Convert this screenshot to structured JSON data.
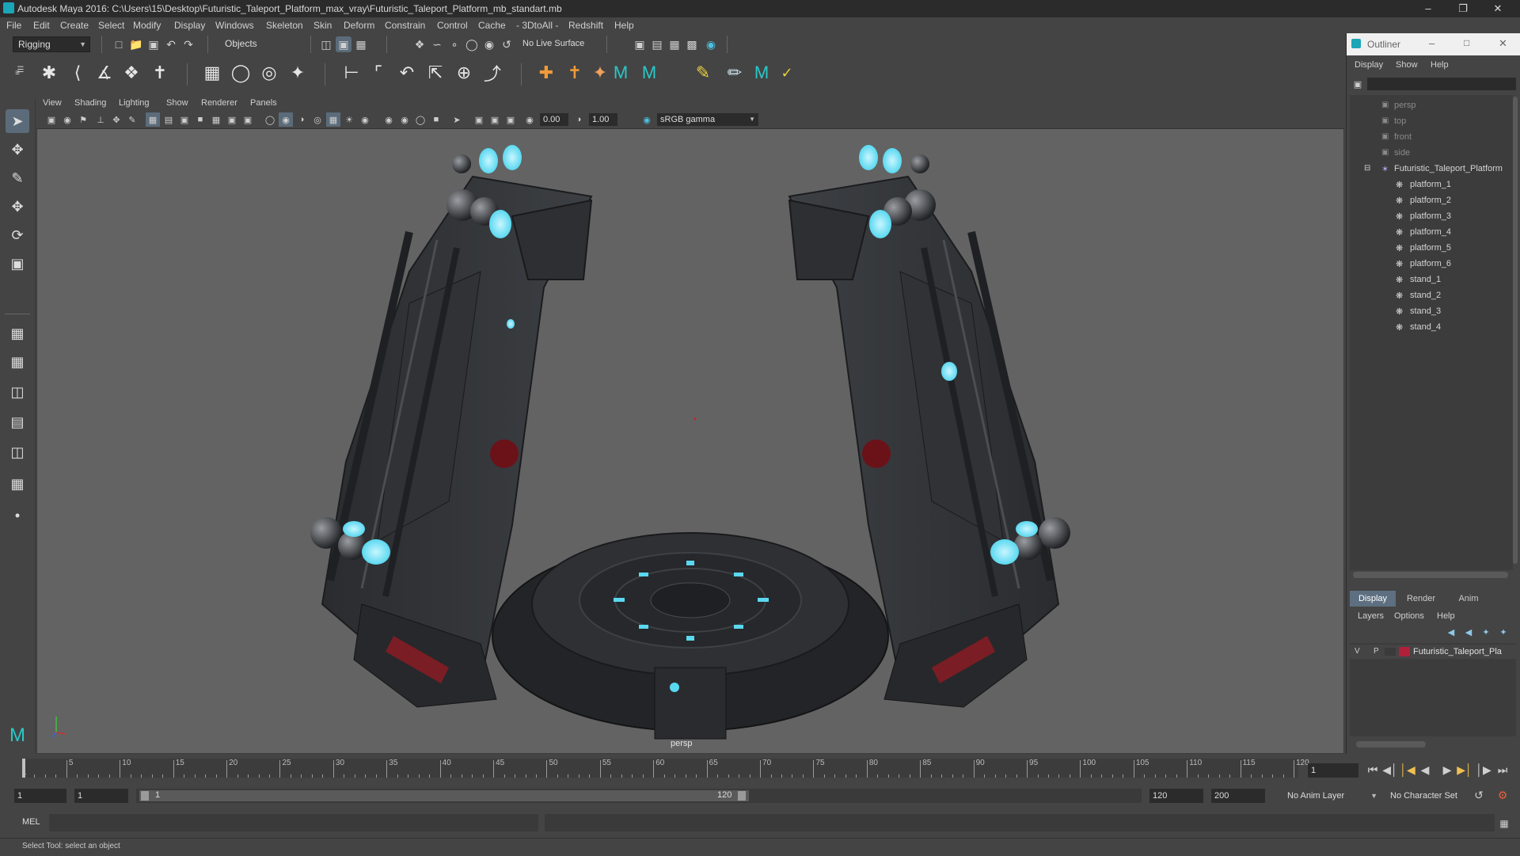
{
  "title_bar": {
    "title": "Autodesk Maya 2016: C:\\Users\\15\\Desktop\\Futuristic_Taleport_Platform_max_vray\\Futuristic_Taleport_Platform_mb_standart.mb"
  },
  "menu": [
    "File",
    "Edit",
    "Create",
    "Select",
    "Modify",
    "Display",
    "Windows",
    "Skeleton",
    "Skin",
    "Deform",
    "Constrain",
    "Control",
    "Cache",
    "- 3DtoAll -",
    "Redshift",
    "Help"
  ],
  "status_line": {
    "mode": "Rigging",
    "selection_mask": "Objects",
    "live_surface": "No Live Surface"
  },
  "viewport": {
    "menu": [
      "View",
      "Shading",
      "Lighting",
      "Show",
      "Renderer",
      "Panels"
    ],
    "exposure": "0.00",
    "gamma": "1.00",
    "color_space": "sRGB gamma",
    "camera_label": "persp"
  },
  "outliner": {
    "title": "Outliner",
    "menu": [
      "Display",
      "Show",
      "Help"
    ],
    "cameras": [
      "persp",
      "top",
      "front",
      "side"
    ],
    "group": "Futuristic_Taleport_Platform",
    "children": [
      "platform_1",
      "platform_2",
      "platform_3",
      "platform_4",
      "platform_5",
      "platform_6",
      "stand_1",
      "stand_2",
      "stand_3",
      "stand_4"
    ]
  },
  "layer_editor": {
    "tabs": [
      "Display",
      "Render",
      "Anim"
    ],
    "menu": [
      "Layers",
      "Options",
      "Help"
    ],
    "layer": {
      "visible": "V",
      "playback": "P",
      "name": "Futuristic_Taleport_Pla",
      "color": "#b0203a"
    }
  },
  "time_slider": {
    "ticks": [
      "5",
      "10",
      "15",
      "20",
      "25",
      "30",
      "35",
      "40",
      "45",
      "50",
      "55",
      "60",
      "65",
      "70",
      "75",
      "80",
      "85",
      "90",
      "95",
      "100",
      "105",
      "110",
      "115",
      "120"
    ],
    "current_frame_marker": "1",
    "current_frame": "1"
  },
  "range_slider": {
    "start": "1",
    "playback_start": "1",
    "bar_start": "1",
    "bar_end": "120",
    "playback_end": "120",
    "end": "200",
    "anim_layer": "No Anim Layer",
    "character_set": "No Character Set"
  },
  "command_line": {
    "lang": "MEL"
  },
  "help_line": {
    "text": "Select Tool: select an object"
  },
  "colors": {
    "accent": "#5ad8f0",
    "bg": "#444444",
    "scene_bg": "#636363"
  }
}
